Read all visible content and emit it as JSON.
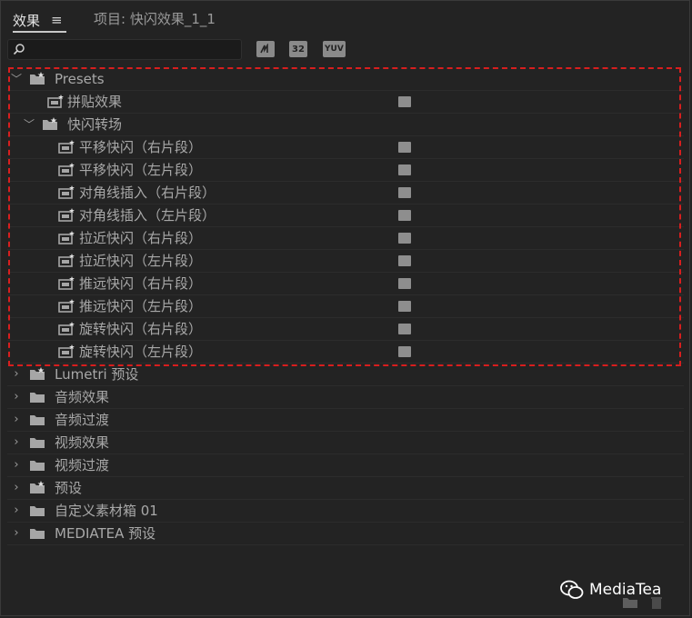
{
  "tabs": {
    "effects_label": "效果",
    "menu_icon": "≡",
    "project_label": "项目: 快闪效果_1_1"
  },
  "toolbar": {
    "search_placeholder": "",
    "btn_accelerated": "",
    "btn_32": "32",
    "btn_yuv": "YUV"
  },
  "tree": {
    "presets_label": "Presets",
    "presets_children": [
      {
        "label": "拼贴效果"
      }
    ],
    "flash_folder_label": "快闪转场",
    "flash_items": [
      "平移快闪（右片段）",
      "平移快闪（左片段）",
      "对角线插入（右片段）",
      "对角线插入（左片段）",
      "拉近快闪（右片段）",
      "拉近快闪（左片段）",
      "推远快闪（右片段）",
      "推远快闪（左片段）",
      "旋转快闪（右片段）",
      "旋转快闪（左片段）"
    ],
    "folders": [
      {
        "label": "Lumetri 预设",
        "icon": "preset-folder"
      },
      {
        "label": "音频效果",
        "icon": "folder"
      },
      {
        "label": "音频过渡",
        "icon": "folder"
      },
      {
        "label": "视频效果",
        "icon": "folder"
      },
      {
        "label": "视频过渡",
        "icon": "folder"
      },
      {
        "label": "预设",
        "icon": "preset-folder"
      },
      {
        "label": "自定义素材箱 01",
        "icon": "folder"
      },
      {
        "label": "MEDIATEA 预设",
        "icon": "folder"
      }
    ]
  },
  "watermark": {
    "text": "MediaTea"
  },
  "colors": {
    "background": "#232323",
    "highlight": "#d81e1e",
    "text": "#a8a8a8"
  }
}
